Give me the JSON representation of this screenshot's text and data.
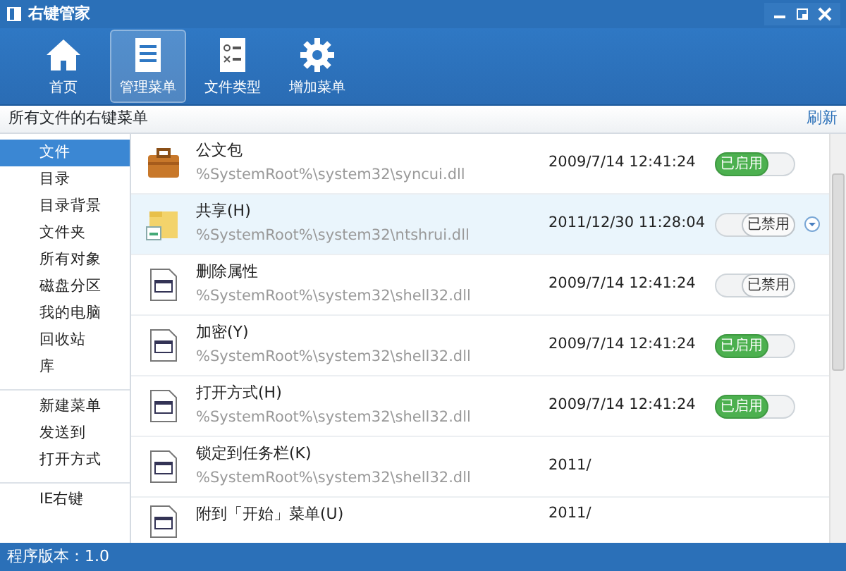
{
  "window": {
    "title": "右键管家"
  },
  "toolbar": [
    {
      "label": "首页",
      "kind": "home",
      "selected": false
    },
    {
      "label": "管理菜单",
      "kind": "menu",
      "selected": true
    },
    {
      "label": "文件类型",
      "kind": "types",
      "selected": false
    },
    {
      "label": "增加菜单",
      "kind": "gear",
      "selected": false
    }
  ],
  "header": {
    "title": "所有文件的右键菜单",
    "refresh": "刷新"
  },
  "sidebar": {
    "groups": [
      [
        {
          "label": "文件",
          "selected": true
        },
        {
          "label": "目录",
          "selected": false
        },
        {
          "label": "目录背景",
          "selected": false
        },
        {
          "label": "文件夹",
          "selected": false
        },
        {
          "label": "所有对象",
          "selected": false
        },
        {
          "label": "磁盘分区",
          "selected": false
        },
        {
          "label": "我的电脑",
          "selected": false
        },
        {
          "label": "回收站",
          "selected": false
        },
        {
          "label": "库",
          "selected": false
        }
      ],
      [
        {
          "label": "新建菜单",
          "selected": false
        },
        {
          "label": "发送到",
          "selected": false
        },
        {
          "label": "打开方式",
          "selected": false
        }
      ],
      [
        {
          "label": "IE右键",
          "selected": false
        }
      ]
    ]
  },
  "rows": [
    {
      "kind": "briefcase",
      "name": "公文包",
      "path": "%SystemRoot%\\system32\\syncui.dll",
      "date": "2009/7/14 12:41:24",
      "toggle": "已启用",
      "enabled": true,
      "selected": false
    },
    {
      "kind": "share",
      "name": "共享(H)",
      "path": "%SystemRoot%\\system32\\ntshrui.dll",
      "date": "2011/12/30 11:28:04",
      "toggle": "已禁用",
      "enabled": false,
      "selected": true
    },
    {
      "kind": "dll",
      "name": "删除属性",
      "path": "%SystemRoot%\\system32\\shell32.dll",
      "date": "2009/7/14 12:41:24",
      "toggle": "已禁用",
      "enabled": false,
      "selected": false
    },
    {
      "kind": "dll",
      "name": "加密(Y)",
      "path": "%SystemRoot%\\system32\\shell32.dll",
      "date": "2009/7/14 12:41:24",
      "toggle": "已启用",
      "enabled": true,
      "selected": false
    },
    {
      "kind": "dll",
      "name": "打开方式(H)",
      "path": "%SystemRoot%\\system32\\shell32.dll",
      "date": "2009/7/14 12:41:24",
      "toggle": "已启用",
      "enabled": true,
      "selected": false
    },
    {
      "kind": "dll",
      "name": "锁定到任务栏(K)",
      "path": "%SystemRoot%\\system32\\shell32.dll",
      "date": "2011/",
      "selected": false
    },
    {
      "kind": "dll",
      "name": "附到「开始」菜单(U)",
      "date": "2011/",
      "selected": false
    }
  ],
  "status_bar": "程序版本：1.0"
}
